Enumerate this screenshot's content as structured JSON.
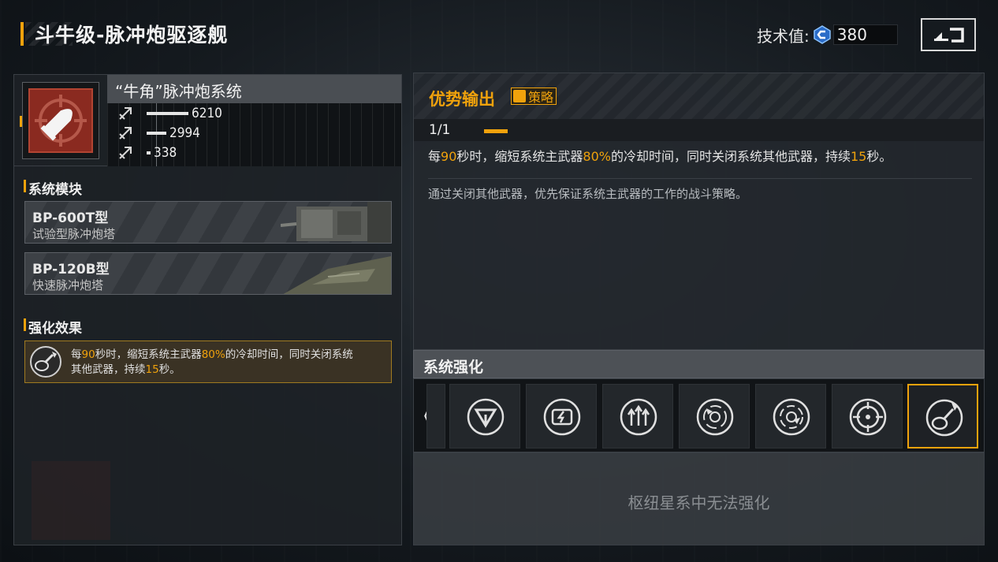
{
  "header": {
    "title": "斗牛级-脉冲炮驱逐舰",
    "tech_label": "技术值:",
    "tech_value": "380"
  },
  "weapon": {
    "name": "“牛角”脉冲炮系统",
    "stats": [
      {
        "icon": "attack-arrow-icon",
        "value": "6210",
        "fraction": 0.85
      },
      {
        "icon": "attack-arrow-icon",
        "value": "2994",
        "fraction": 0.41
      },
      {
        "icon": "attack-arrow-icon",
        "value": "338",
        "fraction": 0.08
      }
    ]
  },
  "modules_section": {
    "title": "系统模块",
    "items": [
      {
        "name": "BP-600T型",
        "desc": "试验型脉冲炮塔"
      },
      {
        "name": "BP-120B型",
        "desc": "快速脉冲炮塔"
      }
    ]
  },
  "enhance_section": {
    "title": "强化效果",
    "text_parts": [
      "每",
      "90",
      "秒时，缩短系统主武器",
      "80%",
      "的冷却时间，同时关闭系统",
      "其他武器，持续",
      "15",
      "秒。"
    ]
  },
  "skill": {
    "title": "优势输出",
    "tag": "策略",
    "level": "1/1",
    "desc_parts": [
      "每",
      "90",
      "秒时，缩短系统主武器",
      "80%",
      "的冷却时间，同时关闭系统其他武器，持续",
      "15",
      "秒。"
    ],
    "flavor": "通过关闭其他武器，优先保证系统主武器的工作的战斗策略。"
  },
  "strengthen": {
    "title": "系统强化",
    "scroll_left": "《",
    "slots": [
      {
        "icon": "triangle-emblem-icon",
        "selected": false
      },
      {
        "icon": "energy-card-icon",
        "selected": false
      },
      {
        "icon": "triple-arrow-up-icon",
        "selected": false
      },
      {
        "icon": "radar-swirl-icon",
        "selected": false
      },
      {
        "icon": "radar-swirl-alt-icon",
        "selected": false
      },
      {
        "icon": "crosshair-target-icon",
        "selected": false
      },
      {
        "icon": "guitar-pick-icon",
        "selected": true
      }
    ],
    "locked_text": "枢纽星系中无法强化"
  },
  "colors": {
    "accent": "#f0a20c",
    "weapon_icon_bg": "#8a2a20"
  }
}
